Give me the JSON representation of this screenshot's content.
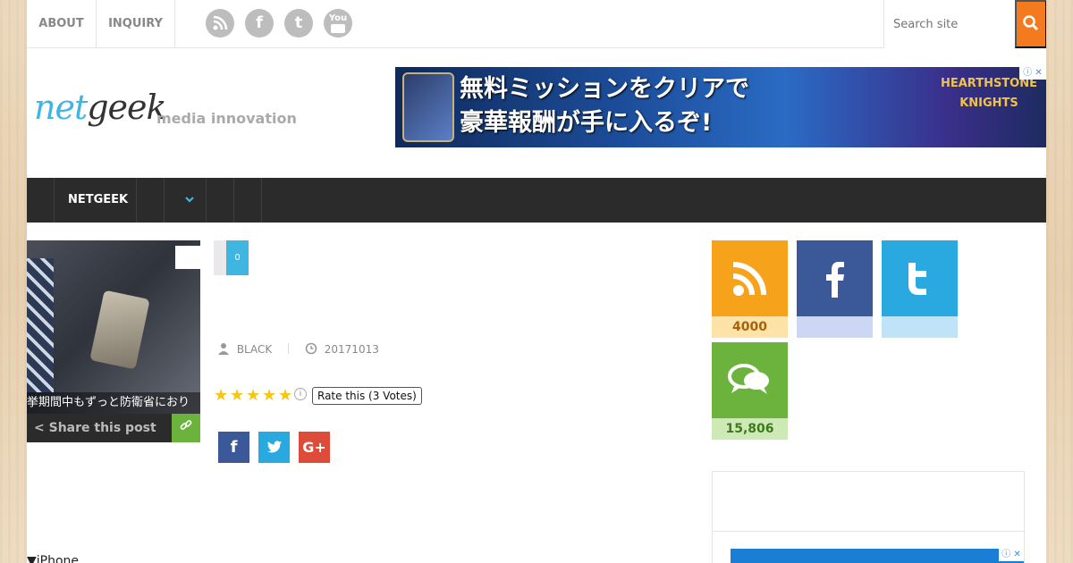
{
  "topbar": {
    "links": [
      "ABOUT",
      "INQUIRY"
    ],
    "social_icons": [
      "rss-icon",
      "facebook-icon",
      "twitter-icon",
      "youtube-icon"
    ],
    "youtube_label": "You",
    "search_placeholder": "Search site"
  },
  "header": {
    "logo_part1": "net",
    "logo_part2": "geek",
    "tagline": "media innovation",
    "banner": {
      "line1": "無料ミッションをクリアで",
      "line2": "豪華報酬が手に入るぞ!",
      "brand1": "HEARTHSTONE",
      "brand2": "KNIGHTS"
    }
  },
  "nav": {
    "items": [
      "NETGEEK"
    ]
  },
  "post": {
    "thumbnail_caption": "挙期間中もずっと防衛省におり",
    "share_label": "Share this post",
    "share_count": "0",
    "author": "BLACK",
    "date": "20171013",
    "rating": {
      "stars": 5,
      "label": "Rate this (3 Votes)"
    },
    "bottom_text": "▼iPhone"
  },
  "sidebar": {
    "tiles": [
      {
        "name": "rss",
        "count": "4000",
        "color": "#f7a21b",
        "count_bg": "#fde3a7",
        "count_color": "#a8610a"
      },
      {
        "name": "facebook",
        "count": "",
        "color": "#3b5998",
        "count_bg": "#ccd7f5",
        "count_color": "#3b5998"
      },
      {
        "name": "twitter",
        "count": "",
        "color": "#2aa9e0",
        "count_bg": "#bfe4f7",
        "count_color": "#2aa9e0"
      },
      {
        "name": "comments",
        "count": "15,806",
        "color": "#6cb33e",
        "count_bg": "#cde9b6",
        "count_color": "#3d7a1c"
      }
    ]
  },
  "colors": {
    "accent_blue": "#3fb5e1",
    "search_orange": "#f47a20",
    "nav_dark": "#2b2b2b",
    "star_yellow": "#f5c518"
  }
}
